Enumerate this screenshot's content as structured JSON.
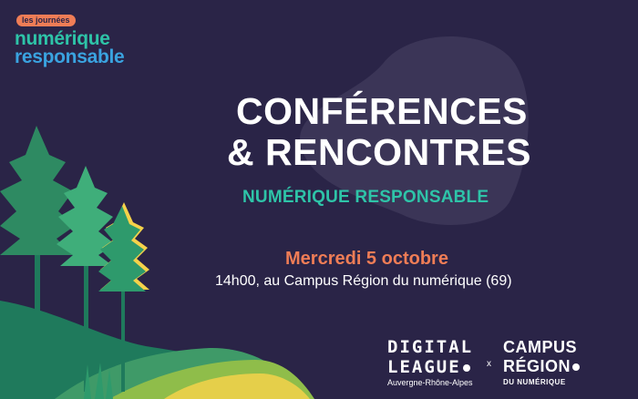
{
  "brand": {
    "tag": "les journées",
    "line1": "numérique",
    "line2": "responsable"
  },
  "headline": {
    "line1": "CONFÉRENCES",
    "line2": "& RENCONTRES"
  },
  "subtitle": "NUMÉRIQUE RESPONSABLE",
  "event": {
    "date": "Mercredi 5 octobre",
    "place": "14h00, au Campus Région du numérique (69)"
  },
  "partners": {
    "digital_line1": "DIGITAL",
    "digital_line2": "LEAGUE",
    "digital_sub": "Auvergne-Rhône-Alpes",
    "separator": "x",
    "campus_line1": "CAMPUS",
    "campus_line2": "RÉGION",
    "campus_sub": "DU NUMÉRIQUE"
  },
  "colors": {
    "background": "#2a2447",
    "teal": "#2ec4a8",
    "orange": "#ef7d56",
    "blue": "#3aa3e0",
    "forest_dark": "#1f7a5c",
    "forest_mid": "#2e9a6c",
    "yellow": "#f5d24a"
  }
}
